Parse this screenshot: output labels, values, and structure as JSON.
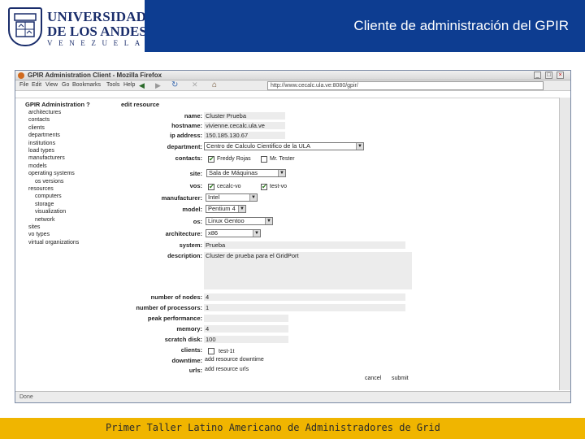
{
  "slide": {
    "logo_line1": "UNIVERSIDAD",
    "logo_line2": "DE LOS ANDES",
    "logo_line3": "VENEZUELA",
    "title": "Cliente de administración del GPIR",
    "footer": "Primer Taller Latino Americano de Administradores de Grid",
    "colors": {
      "header_bar": "#0d3d91",
      "footer_bar": "#f0b500",
      "logo": "#1a2d6b"
    }
  },
  "browser": {
    "window_title": "GPIR Administration Client - Mozilla Firefox",
    "menu": [
      "File",
      "Edit",
      "View",
      "Go",
      "Bookmarks",
      "Tools",
      "Help"
    ],
    "url": "http://www.cecalc.ula.ve:8080/gpir/",
    "status": "Done",
    "toolbar_icons": [
      "back-icon",
      "forward-icon",
      "reload-icon",
      "stop-icon",
      "home-icon"
    ]
  },
  "sidebar": {
    "title": "GPIR Administration ?",
    "items": [
      {
        "label": "architectures",
        "indent": 0
      },
      {
        "label": "contacts",
        "indent": 0
      },
      {
        "label": "clients",
        "indent": 0
      },
      {
        "label": "departments",
        "indent": 0
      },
      {
        "label": "institutions",
        "indent": 0
      },
      {
        "label": "load types",
        "indent": 0
      },
      {
        "label": "manufacturers",
        "indent": 0
      },
      {
        "label": "models",
        "indent": 0
      },
      {
        "label": "operating systems",
        "indent": 0
      },
      {
        "label": "os versions",
        "indent": 1
      },
      {
        "label": "resources",
        "indent": 0
      },
      {
        "label": "computers",
        "indent": 1
      },
      {
        "label": "storage",
        "indent": 1
      },
      {
        "label": "visualization",
        "indent": 1
      },
      {
        "label": "network",
        "indent": 1
      },
      {
        "label": "sites",
        "indent": 0
      },
      {
        "label": "vo types",
        "indent": 0
      },
      {
        "label": "virtual organizations",
        "indent": 0
      }
    ]
  },
  "form": {
    "title": "edit resource",
    "name_label": "name:",
    "name_value": "Cluster Prueba",
    "hostname_label": "hostname:",
    "hostname_value": "vivienne.cecalc.ula.ve",
    "ip_label": "ip address:",
    "ip_value": "150.185.130.67",
    "department_label": "department:",
    "department_value": "Centro de Calculo Cientifico de la ULA",
    "contacts_label": "contacts:",
    "contact1": "Freddy Rojas",
    "contact2": "Mr. Tester",
    "site_label": "site:",
    "site_value": "Sala de Máquinas",
    "vos_label": "vos:",
    "vo1": "cecalc-vo",
    "vo2": "test-vo",
    "manufacturer_label": "manufacturer:",
    "manufacturer_value": "Intel",
    "model_label": "model:",
    "model_value": "Pentium 4",
    "os_label": "os:",
    "os_value": "Linux Gentoo",
    "architecture_label": "architecture:",
    "architecture_value": "x86",
    "system_label": "system:",
    "system_value": "Prueba",
    "description_label": "description:",
    "description_value": "Cluster de prueba para el GridPort",
    "nodes_label": "number of nodes:",
    "nodes_value": "4",
    "processors_label": "number of processors:",
    "processors_value": "1",
    "peak_label": "peak performance:",
    "peak_value": "",
    "memory_label": "memory:",
    "memory_value": "4",
    "scratch_label": "scratch disk:",
    "scratch_value": "100",
    "clients_label": "clients:",
    "client1": "test-1t",
    "downtime_label": "downtime:",
    "downtime_value": "add resource downtime",
    "urls_label": "urls:",
    "urls_value": "add resource urls",
    "cancel_label": "cancel",
    "submit_label": "submit"
  }
}
